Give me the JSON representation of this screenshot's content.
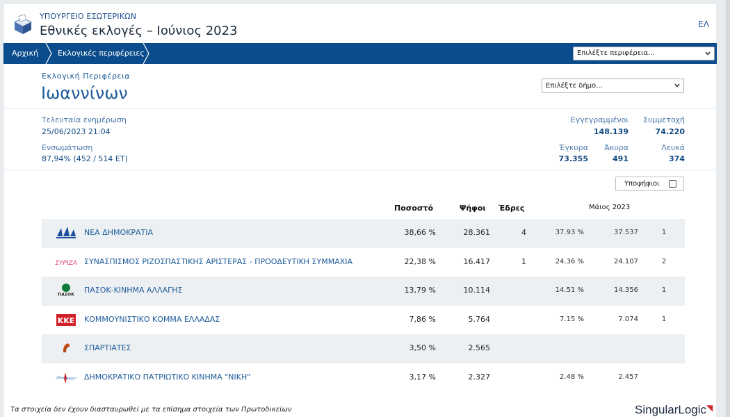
{
  "header": {
    "ministry": "ΥΠΟΥΡΓΕΙΟ ΕΣΩΤΕΡΙΚΩΝ",
    "title": "Εθνικές εκλογές – Ιούνιος 2023",
    "lang": "ΕΛ",
    "logo_icon": "ballot-box-icon"
  },
  "nav": {
    "crumbs": [
      "Αρχική",
      "Εκλογικές περιφέρειες"
    ],
    "region_select_placeholder": "Επιλέξτε περιφέρεια..."
  },
  "region": {
    "label": "Εκλογική Περιφέρεια",
    "name": "Ιωαννίνων",
    "municipality_placeholder": "Επιλέξτε δήμο..."
  },
  "stats": {
    "last_update_label": "Τελευταία ενημέρωση",
    "last_update_value": "25/06/2023 21:04",
    "integration_label": "Ενσωμάτωση",
    "integration_value": "87,94% (452 / 514 ΕΤ)",
    "registered_label": "Εγγεγραμμένοι",
    "registered_value": "148.139",
    "turnout_label": "Συμμετοχή",
    "turnout_value": "74.220",
    "valid_label": "Έγκυρα",
    "valid_value": "73.355",
    "invalid_label": "Άκυρα",
    "invalid_value": "491",
    "blank_label": "Λευκά",
    "blank_value": "374"
  },
  "table": {
    "candidates_toggle": "Υποψήφιοι",
    "headers": {
      "percent": "Ποσοστό",
      "votes": "Ψήφοι",
      "seats": "Έδρες",
      "previous": "Μάιος 2023"
    },
    "rows": [
      {
        "name": "ΝΕΑ ΔΗΜΟΚΡΑΤΙΑ",
        "percent": "38,66 %",
        "votes": "28.361",
        "seats": "4",
        "prev_percent": "37.93 %",
        "prev_votes": "37.537",
        "prev_seats": "1",
        "logo": "nd-logo-icon",
        "color": "#1d4e9e"
      },
      {
        "name": "ΣΥΝΑΣΠΙΣΜΟΣ ΡΙΖΟΣΠΑΣΤΙΚΗΣ ΑΡΙΣΤΕΡΑΣ - ΠΡΟΟΔΕΥΤΙΚΗ ΣΥΜΜΑΧΙΑ",
        "percent": "22,38 %",
        "votes": "16.417",
        "seats": "1",
        "prev_percent": "24.36 %",
        "prev_votes": "24.107",
        "prev_seats": "2",
        "logo": "syriza-logo-icon",
        "color": "#e04070",
        "logo_text": "ΣΥΡΙΖΑ"
      },
      {
        "name": "ΠΑΣΟΚ-ΚΙΝΗΜΑ ΑΛΛΑΓΗΣ",
        "percent": "13,79 %",
        "votes": "10.114",
        "seats": "",
        "prev_percent": "14.51 %",
        "prev_votes": "14.356",
        "prev_seats": "1",
        "logo": "pasok-logo-icon",
        "color": "#0b7a3a",
        "logo_text": "ΠΑΣΟΚ"
      },
      {
        "name": "ΚΟΜΜΟΥΝΙΣΤΙΚΟ ΚΟΜΜΑ ΕΛΛΑΔΑΣ",
        "percent": "7,86 %",
        "votes": "5.764",
        "seats": "",
        "prev_percent": "7.15 %",
        "prev_votes": "7.074",
        "prev_seats": "1",
        "logo": "kke-logo-icon",
        "color": "#d2202a",
        "logo_text": "ΚΚΕ"
      },
      {
        "name": "ΣΠΑΡΤΙΑΤΕΣ",
        "percent": "3,50 %",
        "votes": "2.565",
        "seats": "",
        "prev_percent": "",
        "prev_votes": "",
        "prev_seats": "",
        "logo": "spartiates-logo-icon",
        "color": "#c8531b"
      },
      {
        "name": "ΔΗΜΟΚΡΑΤΙΚΟ ΠΑΤΡΙΩΤΙΚΟ ΚΙΝΗΜΑ \"ΝΙΚΗ\"",
        "percent": "3,17 %",
        "votes": "2.327",
        "seats": "",
        "prev_percent": "2.48 %",
        "prev_votes": "2.457",
        "prev_seats": "",
        "logo": "niki-logo-icon",
        "color": "#3a7cc0"
      }
    ]
  },
  "footer": {
    "note": "Τα στοιχεία δεν έχουν διασταυρωθεί με τα επίσημα στοιχεία των Πρωτοδικείων",
    "brand": "SingularLogic"
  },
  "colors": {
    "navbar": "#0b4d8c",
    "accent": "#1c5a99",
    "row_shade": "#edf0f3"
  }
}
